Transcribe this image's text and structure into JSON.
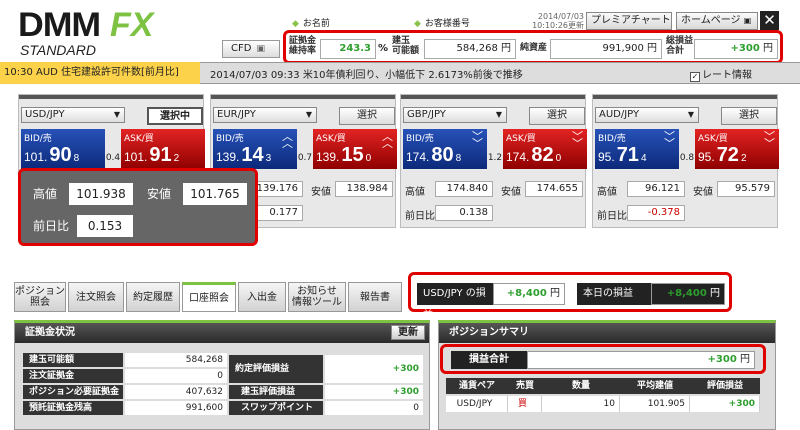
{
  "brand": {
    "main": "DMM",
    "fx": "FX",
    "sub": "STANDARD"
  },
  "header": {
    "name_label": "お名前",
    "customer_label": "お客様番号",
    "date": "2014/07/03",
    "time": "10:10:26更新",
    "premium_chart": "プレミアチャート",
    "homepage": "ホームページ",
    "close": "✕",
    "cfd": "CFD"
  },
  "account": {
    "margin_ratio_label1": "証拠金",
    "margin_ratio_label2": "維持率",
    "margin_ratio_value": "243.3",
    "margin_ratio_unit": "%",
    "available_label1": "建玉",
    "available_label2": "可能額",
    "available_value": "584,268",
    "available_unit": "円",
    "net_assets_label": "純資産",
    "net_assets_value": "991,900",
    "net_assets_unit": "円",
    "total_pl_label1": "総損益",
    "total_pl_label2": "合計",
    "total_pl_value": "+300",
    "total_pl_unit": "円"
  },
  "news": {
    "ticker": "10:30 AUD 住宅建設許可件数[前月比]",
    "headline": "2014/07/03 09:33 米10年債利回り、小幅低下 2.6173%前後で推移",
    "rate_info": "レート情報",
    "rate_info_checked": "✓"
  },
  "pairs": [
    {
      "pair": "USD/JPY",
      "select": "選択中",
      "bid_label": "BID/売",
      "ask_label": "ASK/買",
      "bid_a": "101.",
      "bid_b": "90",
      "bid_c": "8",
      "ask_a": "101.",
      "ask_b": "91",
      "ask_c": "2",
      "spread": "0.4",
      "high_label": "高値",
      "high": "101.938",
      "low_label": "安値",
      "low": "101.765",
      "change_label": "前日比",
      "change": "0.153"
    },
    {
      "pair": "EUR/JPY",
      "select": "選択",
      "bid_label": "BID/売",
      "ask_label": "ASK/買",
      "bid_a": "139.",
      "bid_b": "14",
      "bid_c": "3",
      "ask_a": "139.",
      "ask_b": "15",
      "ask_c": "0",
      "spread": "0.7",
      "high_label": "高値",
      "high": "139.176",
      "low_label": "安値",
      "low": "138.984",
      "change_label": "前日比",
      "change": "0.177"
    },
    {
      "pair": "GBP/JPY",
      "select": "選択",
      "bid_label": "BID/売",
      "ask_label": "ASK/買",
      "bid_a": "174.",
      "bid_b": "80",
      "bid_c": "8",
      "ask_a": "174.",
      "ask_b": "82",
      "ask_c": "0",
      "spread": "1.2",
      "high_label": "高値",
      "high": "174.840",
      "low_label": "安値",
      "low": "174.655",
      "change_label": "前日比",
      "change": "0.138"
    },
    {
      "pair": "AUD/JPY",
      "select": "選択",
      "bid_label": "BID/売",
      "ask_label": "ASK/買",
      "bid_a": "95.",
      "bid_b": "71",
      "bid_c": "4",
      "ask_a": "95.",
      "ask_b": "72",
      "ask_c": "2",
      "spread": "0.8",
      "high_label": "高値",
      "high": "96.121",
      "low_label": "安値",
      "low": "95.579",
      "change_label": "前日比",
      "change": "-0.378"
    }
  ],
  "tabs": [
    "ポジション\n照会",
    "注文照会",
    "約定履歴",
    "口座照会",
    "入出金",
    "お知らせ\n情報ツール",
    "報告書"
  ],
  "pnl": {
    "usdjpy_label": "USD/JPY の損益",
    "usdjpy_value": "+8,400",
    "usdjpy_unit": "円",
    "today_label": "本日の損益",
    "today_value": "+8,400",
    "today_unit": "円"
  },
  "margin_status": {
    "title": "証拠金状況",
    "refresh": "更新",
    "rows": [
      {
        "label": "建玉可能額",
        "value": "584,268"
      },
      {
        "label": "注文証拠金",
        "value": "0"
      },
      {
        "label": "ポジション必要証拠金",
        "value": "407,632"
      },
      {
        "label": "預託証拠金残高",
        "value": "991,600"
      }
    ],
    "settled_label": "約定評価損益",
    "settled_value": "+300",
    "position_pl_label": "建玉評価損益",
    "position_pl_value": "+300",
    "swap_label": "スワップポイント",
    "swap_value": "0"
  },
  "position_summary": {
    "title": "ポジションサマリ",
    "total_label": "損益合計",
    "total_value": "+300",
    "total_unit": "円",
    "headers": [
      "通貨ペア",
      "売買",
      "数量",
      "平均建値",
      "評価損益"
    ],
    "rows": [
      {
        "pair": "USD/JPY",
        "side": "買",
        "qty": "10",
        "avg": "101.905",
        "pl": "+300"
      }
    ]
  }
}
